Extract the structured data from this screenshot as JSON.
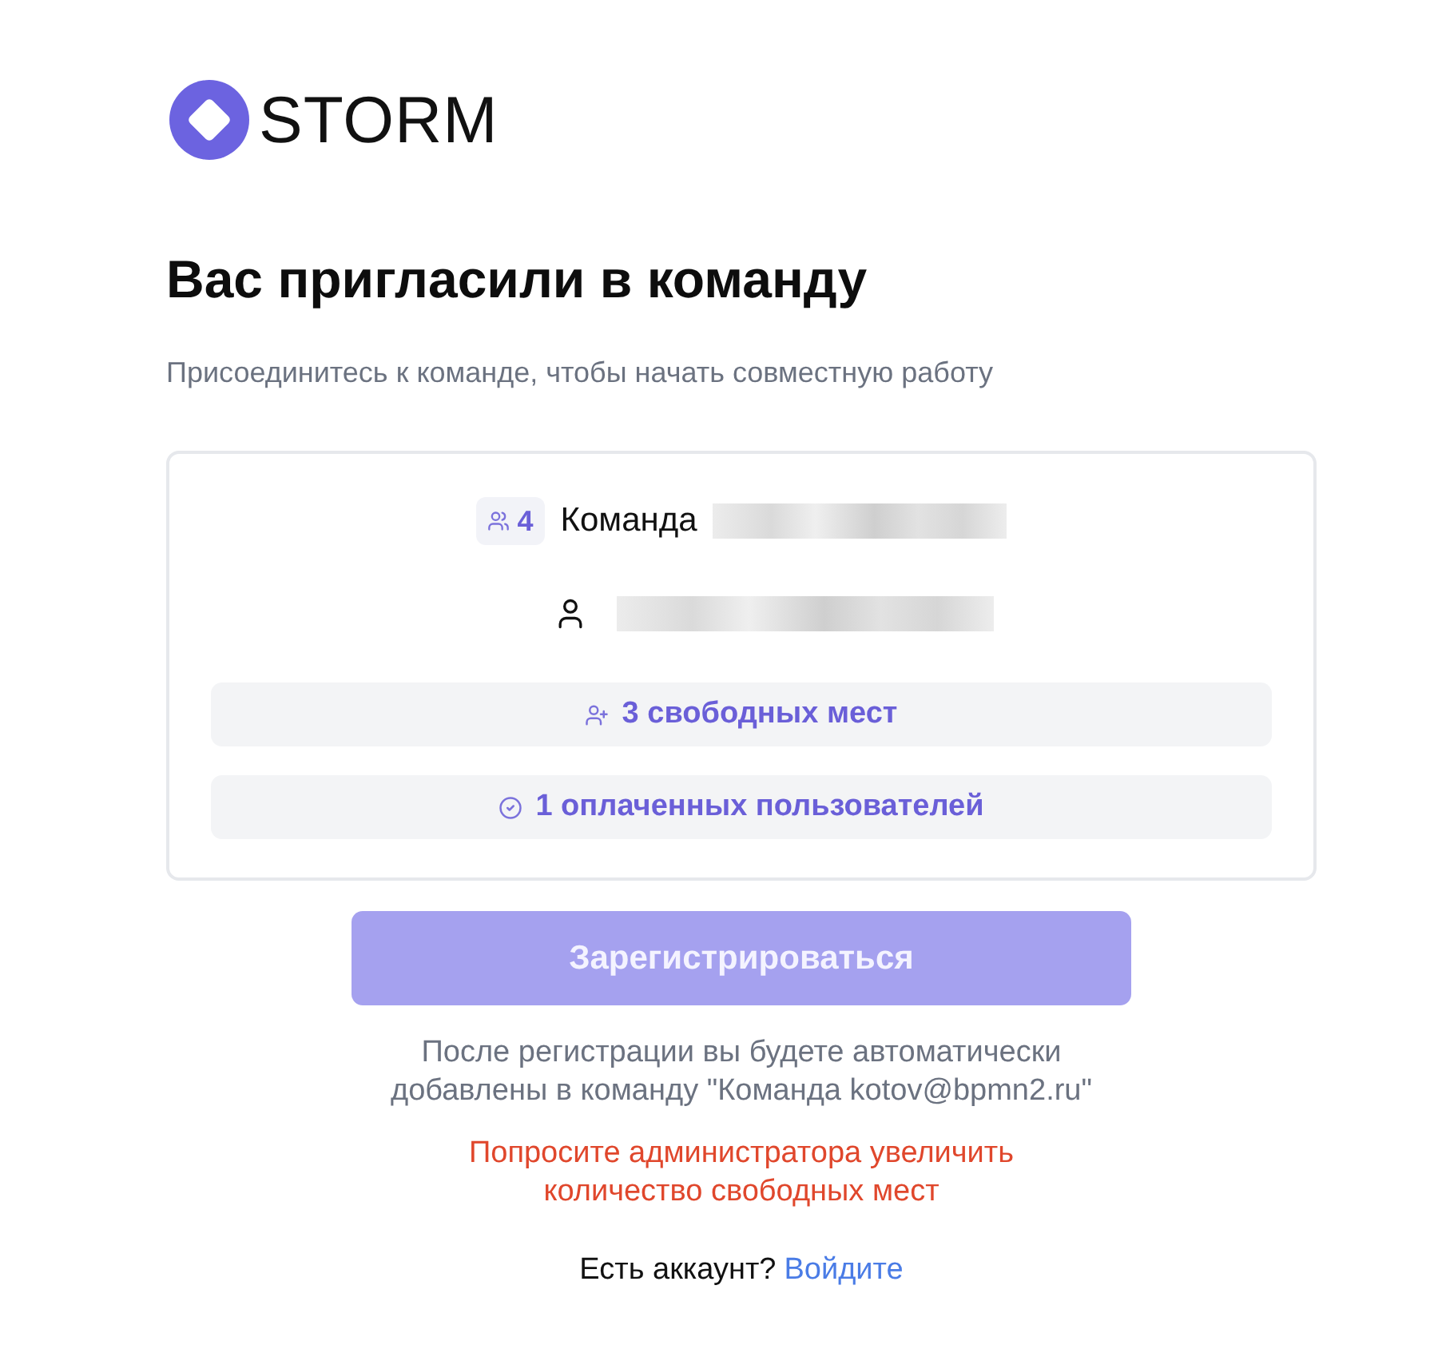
{
  "logo": {
    "text": "STORM"
  },
  "title": "Вас пригласили в команду",
  "subtitle": "Присоединитесь к команде, чтобы начать совместную работу",
  "team_card": {
    "member_count": "4",
    "team_label": "Команда",
    "stats": [
      {
        "kind": "free_seats",
        "text": "3 свободных мест"
      },
      {
        "kind": "paid_users",
        "text": "1 оплаченных пользователей"
      }
    ]
  },
  "register_button": {
    "label": "Зарегистрироваться",
    "disabled": true
  },
  "note": "После регистрации вы будете автоматически добавлены в команду \"Команда kotov@bpmn2.ru\"",
  "warning": "Попросите администратора увеличить количество свободных мест",
  "login_prompt": {
    "text": "Есть аккаунт?",
    "link": "Войдите"
  }
}
